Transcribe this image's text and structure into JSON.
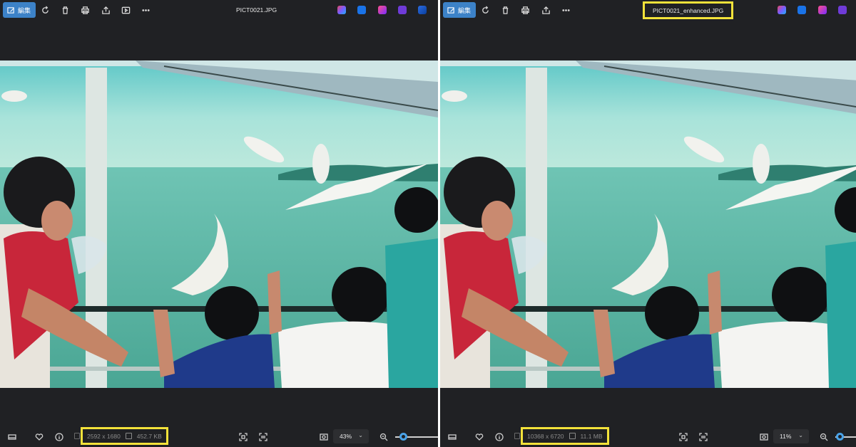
{
  "left": {
    "toolbar": {
      "edit_label": "編集",
      "file_name": "PICT0021.JPG"
    },
    "status": {
      "dimensions": "2592 x 1680",
      "file_size": "452.7 KB"
    },
    "zoom": {
      "value": "43%",
      "slider_fraction": 0.12
    }
  },
  "right": {
    "toolbar": {
      "edit_label": "編集",
      "file_name": "PICT0021_enhanced.JPG"
    },
    "status": {
      "dimensions": "10368 x 6720",
      "file_size": "11.1 MB"
    },
    "zoom": {
      "value": "11%",
      "slider_fraction": 0.05
    }
  },
  "colors": {
    "background": "#202124",
    "highlight": "#f3e23a",
    "accent": "#3c82c8",
    "slider": "#4aa3e8"
  },
  "icons": {
    "toolbar": [
      "edit-icon",
      "rotate-icon",
      "delete-icon",
      "print-icon",
      "share-icon",
      "slideshow-icon",
      "more-icon"
    ],
    "bottom": [
      "filmstrip-icon",
      "favorite-icon",
      "info-icon",
      "fit-icon",
      "compare-icon",
      "actual-size-icon",
      "zoom-out-icon"
    ]
  }
}
